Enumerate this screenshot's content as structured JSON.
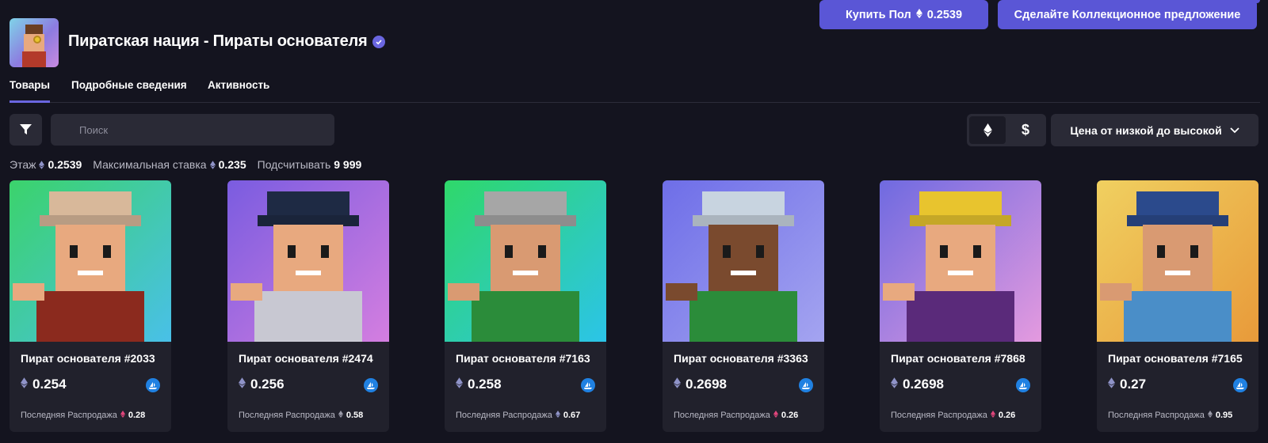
{
  "collection": {
    "title": "Пиратская нация - Пираты основателя",
    "verified_icon": "verified-check-icon"
  },
  "actions": {
    "buy_label": "Купить Пол",
    "buy_price": "0.2539",
    "offer_label": "Сделайте Коллекционное предложение"
  },
  "tabs": [
    {
      "label": "Товары",
      "active": true
    },
    {
      "label": "Подробные сведения",
      "active": false
    },
    {
      "label": "Активность",
      "active": false
    }
  ],
  "toolbar": {
    "search_placeholder": "Поиск",
    "currency_eth_icon": "ethereum-icon",
    "currency_usd": "$",
    "sort_label": "Цена от низкой до высокой"
  },
  "stats": {
    "floor_label": "Этаж",
    "floor_value": "0.2539",
    "max_bid_label": "Максимальная ставка",
    "max_bid_value": "0.235",
    "count_label": "Подсчитывать",
    "count_value": "9 999"
  },
  "last_sale_label": "Последняя Распродажа",
  "colors": {
    "accent": "#5a56d6",
    "background": "#14141f",
    "card": "#21212c",
    "opensea": "#2081e2"
  },
  "items": [
    {
      "name": "Пират основателя #2033",
      "price": "0.254",
      "last_sale": "0.28",
      "sale_color": "#e0457b",
      "bg": [
        "#3bd36b",
        "#49c0e8"
      ],
      "skin": "#e8a97f",
      "hat": "#d8b89a",
      "shirt": "#8b2a1e"
    },
    {
      "name": "Пират основателя #2474",
      "price": "0.256",
      "last_sale": "0.58",
      "sale_color": "#9a9aa8",
      "bg": [
        "#7a5ce0",
        "#d47ee0"
      ],
      "skin": "#e8a97f",
      "hat": "#1e2a44",
      "shirt": "#c8c8d2"
    },
    {
      "name": "Пират основателя #7163",
      "price": "0.258",
      "last_sale": "0.67",
      "sale_color": "#8f93c8",
      "bg": [
        "#2fd86a",
        "#2cc4e8"
      ],
      "skin": "#d99a72",
      "hat": "#a6a6a6",
      "shirt": "#2b8c3a"
    },
    {
      "name": "Пират основателя #3363",
      "price": "0.2698",
      "last_sale": "0.26",
      "sale_color": "#e0457b",
      "bg": [
        "#6e6ee8",
        "#a4a4f0"
      ],
      "skin": "#7a4a2e",
      "hat": "#c8d4e0",
      "shirt": "#2b8c3a"
    },
    {
      "name": "Пират основателя #7868",
      "price": "0.2698",
      "last_sale": "0.26",
      "sale_color": "#e0457b",
      "bg": [
        "#6f6ae0",
        "#e49adf"
      ],
      "skin": "#e8a97f",
      "hat": "#e8c42e",
      "shirt": "#5a2a7a"
    },
    {
      "name": "Пират основателя #7165",
      "price": "0.27",
      "last_sale": "0.95",
      "sale_color": "#9a9aa8",
      "bg": [
        "#f0d060",
        "#e89a3a"
      ],
      "skin": "#d99a72",
      "hat": "#2b4a8c",
      "shirt": "#4a8ec8"
    }
  ]
}
